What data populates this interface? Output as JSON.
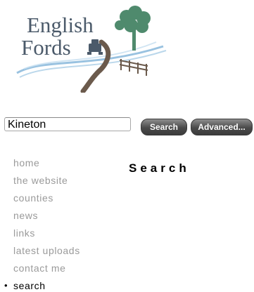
{
  "logo": {
    "line1": "English",
    "line2": "Fords",
    "colors": {
      "text": "#4b5a6a",
      "tree": "#4f8a6d",
      "water": "#7fb3d8",
      "road": "#6b5a4c"
    }
  },
  "search": {
    "value": "Kineton",
    "search_button_label": "Search",
    "advanced_button_label": "Advanced..."
  },
  "nav": {
    "items": [
      {
        "label": "home"
      },
      {
        "label": "the website"
      },
      {
        "label": "counties"
      },
      {
        "label": "news"
      },
      {
        "label": "links"
      },
      {
        "label": "latest uploads"
      },
      {
        "label": "contact me"
      },
      {
        "label": "search",
        "current": true
      }
    ],
    "current_bullet": "•"
  },
  "main": {
    "heading": "Search"
  }
}
